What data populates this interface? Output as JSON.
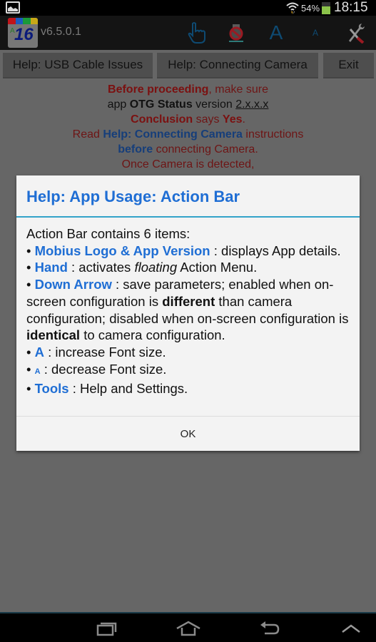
{
  "status_bar": {
    "battery_percent": "54%",
    "battery_level": 0.54,
    "time": "18:15",
    "icons": [
      "image-notification-icon",
      "wifi-icon",
      "battery-icon"
    ]
  },
  "action_bar": {
    "logo_text": "16",
    "logo_small_text": "A",
    "version": "v6.5.0.1",
    "icons": [
      "hand-icon",
      "down-arrow-disabled-icon",
      "font-increase-icon",
      "font-decrease-icon",
      "tools-icon"
    ],
    "font_increase_glyph": "A",
    "font_decrease_glyph": "A",
    "logo_colors": [
      "#c0141a",
      "#1d5bbf",
      "#1a9a3a",
      "#c8a818"
    ]
  },
  "buttons": {
    "usb_help": "Help: USB Cable Issues",
    "connecting_help": "Help: Connecting Camera",
    "exit": "Exit"
  },
  "background_text": {
    "line1_bold": "Before proceeding",
    "line1_rest": ", make sure",
    "line2_pre": "app ",
    "line2_bold": "OTG Status",
    "line2_mid": " version ",
    "line2_underline": "2.x.x.x",
    "line3_bold1": "Conclusion",
    "line3_mid": " says ",
    "line3_bold2": "Yes",
    "line3_end": ".",
    "line4_pre": "Read ",
    "line4_bold": "Help: Connecting Camera",
    "line4_rest": " instructions",
    "line5_bold": "before",
    "line5_rest": " connecting Camera.",
    "line6": "Once Camera is detected,"
  },
  "dialog": {
    "title": "Help: App Usage: Action Bar",
    "intro": "Action Bar contains 6 items:",
    "bullet": "•",
    "items": [
      {
        "keyword": "Mobius Logo & App Version",
        "text": " : displays App details."
      },
      {
        "keyword": "Hand",
        "text_pre": " : activates ",
        "text_italic": "floating",
        "text_post": " Action Menu."
      },
      {
        "keyword": "Down Arrow",
        "text_pre": " : save parameters; enabled when on-screen configuration is ",
        "bold1": "different",
        "text_mid": " than camera configuration; disabled when on-screen configuration is ",
        "bold2": "identical",
        "text_post": " to camera configuration."
      },
      {
        "keyword": "A",
        "text": " : increase Font size."
      },
      {
        "keyword": "A",
        "text": " : decrease Font size."
      },
      {
        "keyword": "Tools",
        "text": " : Help and Settings."
      }
    ],
    "ok_label": "OK",
    "accent_color": "#1f6ed4",
    "separator_color": "#33a3c9"
  },
  "nav_bar": {
    "icons": [
      "recent-apps-icon",
      "home-icon",
      "back-icon",
      "up-chevron-icon"
    ]
  }
}
